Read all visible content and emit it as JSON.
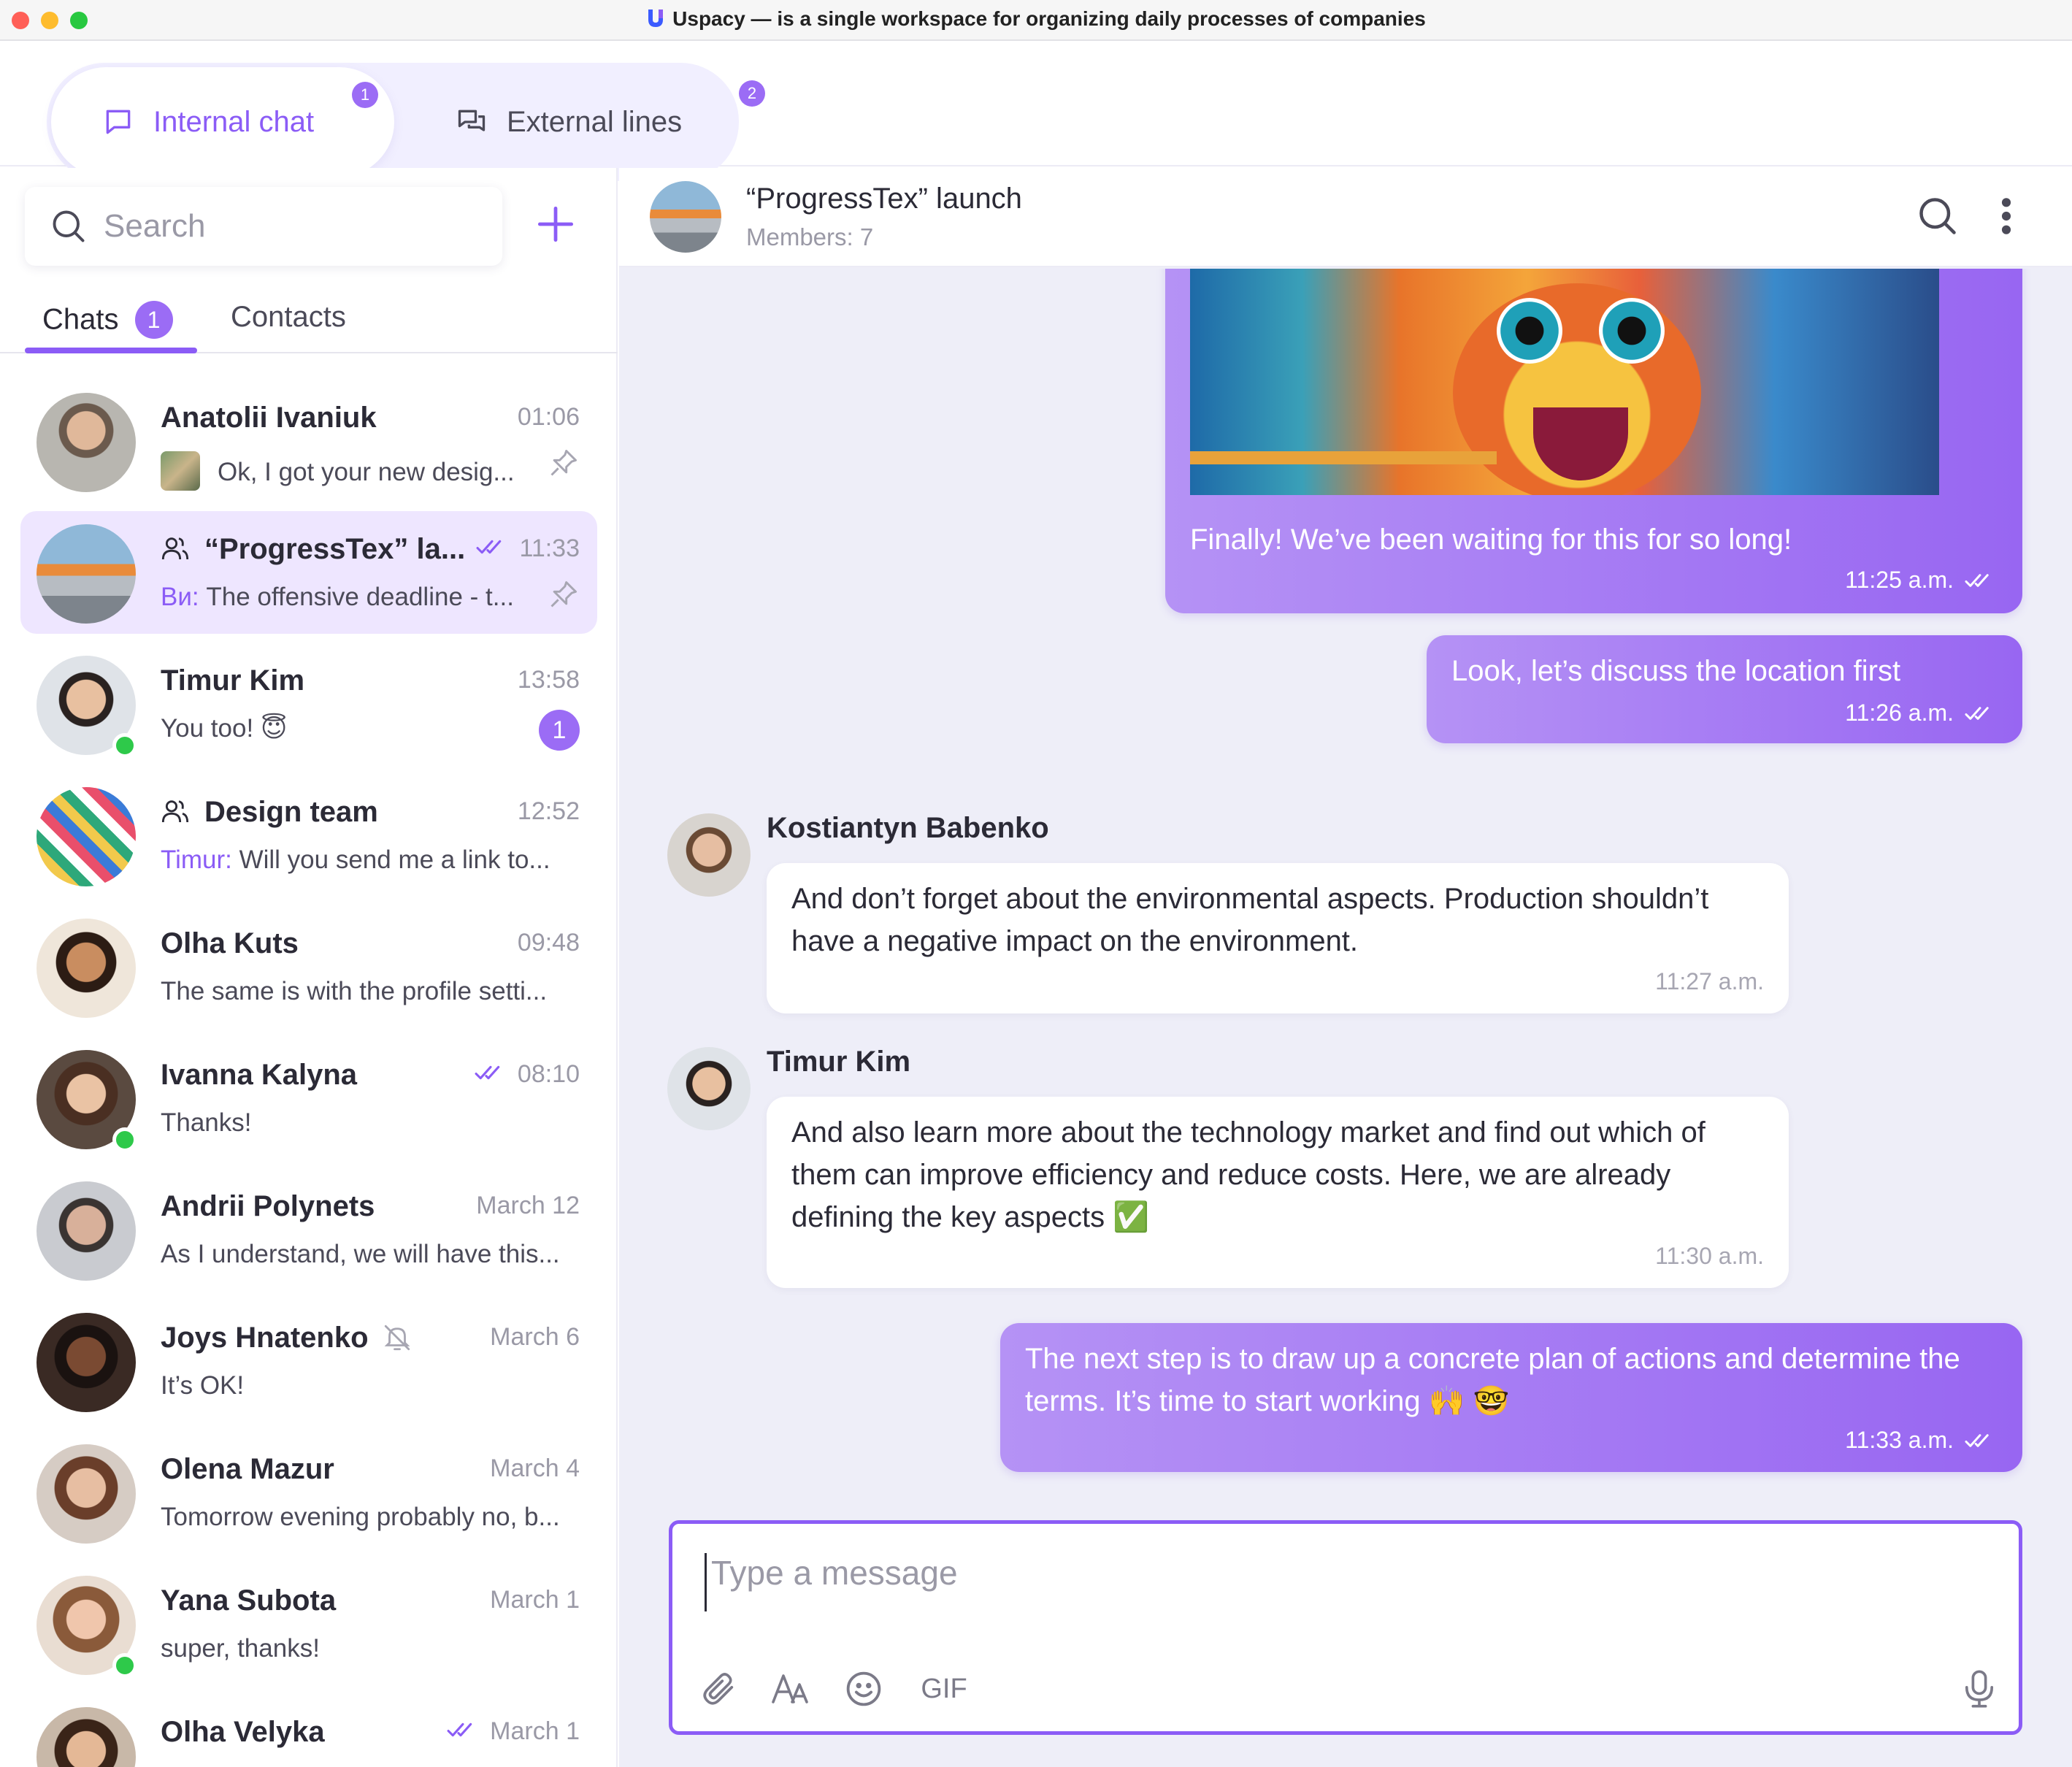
{
  "window": {
    "title": "Uspacy — is a single workspace for organizing daily processes of companies"
  },
  "top_tabs": [
    {
      "label": "Internal chat",
      "badge": "1",
      "active": true
    },
    {
      "label": "External lines",
      "badge": "2",
      "active": false
    }
  ],
  "sidebar": {
    "search_placeholder": "Search",
    "tabs": {
      "chats": "Chats",
      "chats_badge": "1",
      "contacts": "Contacts"
    },
    "chats": [
      {
        "name": "Anatolii Ivaniuk",
        "time": "01:06",
        "preview": "Ok, I got your new desig...",
        "pinned": true
      },
      {
        "name": "“ProgressTex” la...",
        "time": "11:33",
        "sender": "Ви:",
        "preview": "The offensive deadline - t...",
        "pinned": true,
        "group": true,
        "read": true
      },
      {
        "name": "Timur Kim",
        "time": "13:58",
        "preview": "You too! 😇",
        "unread": "1",
        "online": true
      },
      {
        "name": "Design team",
        "time": "12:52",
        "sender": "Timur:",
        "preview": "Will you send me a link to...",
        "group": true
      },
      {
        "name": "Olha Kuts",
        "time": "09:48",
        "preview": "The same is with the profile setti..."
      },
      {
        "name": "Ivanna Kalyna",
        "time": "08:10",
        "preview": "Thanks!",
        "online": true,
        "read": true
      },
      {
        "name": "Andrii Polynets",
        "time": "March 12",
        "preview": "As I understand, we will have this..."
      },
      {
        "name": "Joys Hnatenko",
        "time": "March 6",
        "preview": "It’s OK!",
        "muted": true
      },
      {
        "name": "Olena Mazur",
        "time": "March 4",
        "preview": "Tomorrow evening probably no, b..."
      },
      {
        "name": "Yana Subota",
        "time": "March 1",
        "preview": "super, thanks!",
        "online": true
      },
      {
        "name": "Olha Velyka",
        "time": "March 1",
        "preview": "",
        "read": true
      }
    ]
  },
  "chat": {
    "title": "“ProgressTex” launch",
    "subtitle": "Members: 7",
    "messages": [
      {
        "type": "out",
        "text": "Finally! We’ve been waiting for this for so long!",
        "time": "11:25 a.m.",
        "has_image": true
      },
      {
        "type": "out",
        "text": "Look, let’s discuss the location first",
        "time": "11:26 a.m."
      },
      {
        "type": "in",
        "sender": "Kostiantyn Babenko",
        "text": "And don’t forget about the environmental aspects. Production shouldn’t have a negative impact on the environment.",
        "time": "11:27 a.m."
      },
      {
        "type": "in",
        "sender": "Timur Kim",
        "text": "And also learn more about the technology market and find out which of them can improve efficiency and reduce costs. Here, we are already defining the key aspects ✅",
        "time": "11:30 a.m."
      },
      {
        "type": "out",
        "text": "The next step is to draw up a concrete plan of actions and determine the terms. It’s time to start working 🙌 🤓",
        "time": "11:33 a.m."
      }
    ],
    "composer": {
      "placeholder": "Type a message",
      "gif_label": "GIF"
    }
  },
  "colors": {
    "accent": "#8b5cf6",
    "badge": "#9b6cf5",
    "online": "#2ec94a",
    "chat_bg": "#eeeef8"
  }
}
